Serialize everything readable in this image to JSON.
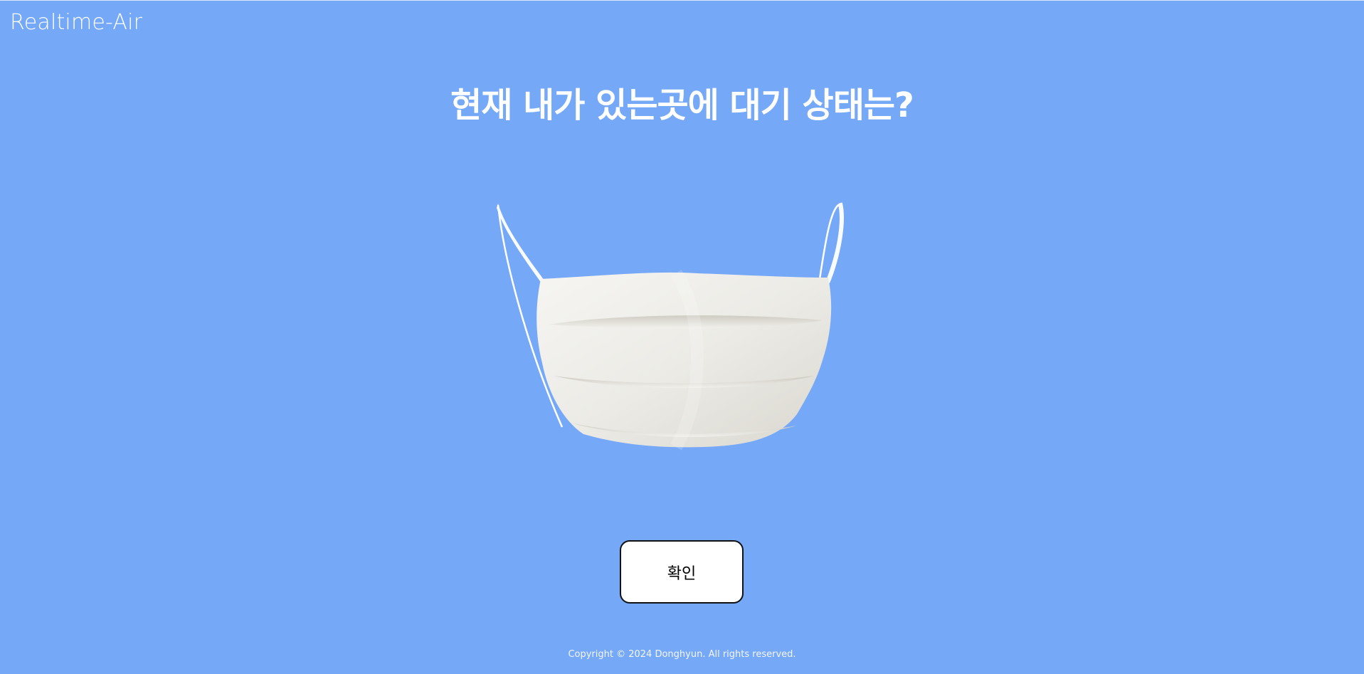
{
  "header": {
    "brand": "Realtime-Air"
  },
  "main": {
    "headline": "현재 내가 있는곳에 대기 상태는?",
    "illustration_icon": "face-mask-icon",
    "confirm_label": "확인"
  },
  "footer": {
    "copyright": "Copyright © 2024 Donghyun. All rights reserved."
  },
  "colors": {
    "background": "#76a8f8",
    "text": "#ffffff",
    "button_bg": "#ffffff",
    "button_border": "#111111"
  }
}
